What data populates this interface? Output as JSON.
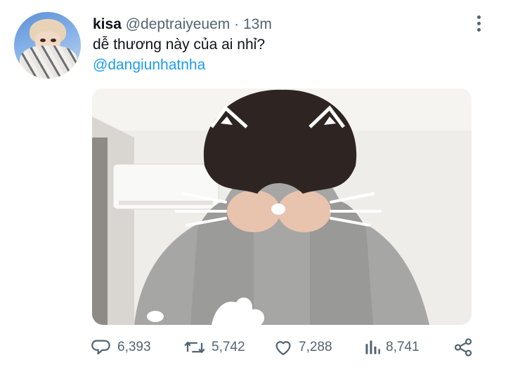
{
  "tweet": {
    "display_name": "kisa",
    "handle": "@deptraiyeuem",
    "separator": "·",
    "time": "13m",
    "text": "dễ thương này của ai nhỉ?",
    "mention": "@dangiunhatnha"
  },
  "actions": {
    "reply": {
      "icon": "reply-icon",
      "count": "6,393"
    },
    "retweet": {
      "icon": "retweet-icon",
      "count": "5,742"
    },
    "like": {
      "icon": "heart-icon",
      "count": "7,288"
    },
    "views": {
      "icon": "views-chart-icon",
      "count": "8,741"
    },
    "share": {
      "icon": "share-icon"
    }
  },
  "colors": {
    "text": "#0f1419",
    "secondary": "#536471",
    "link": "#1d9bf0"
  }
}
